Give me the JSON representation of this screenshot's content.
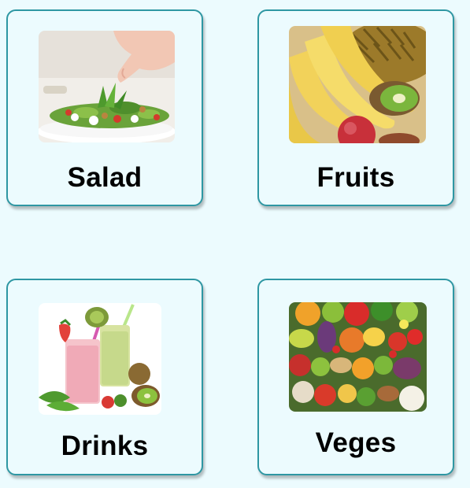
{
  "categories": [
    {
      "label": "Salad"
    },
    {
      "label": "Fruits"
    },
    {
      "label": "Drinks"
    },
    {
      "label": "Veges"
    }
  ]
}
